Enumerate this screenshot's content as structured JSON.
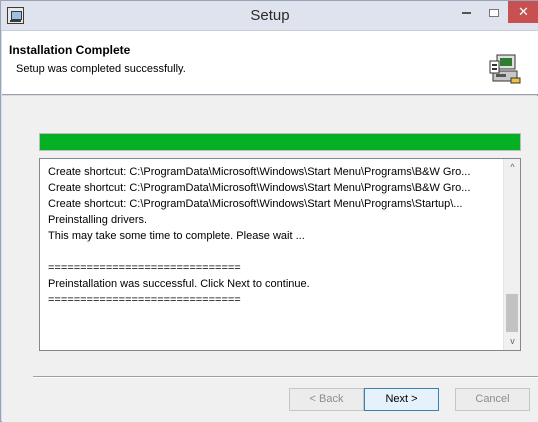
{
  "window": {
    "title": "Setup",
    "close_symbol": "✕"
  },
  "header": {
    "title": "Installation Complete",
    "subtitle": "Setup was completed successfully.",
    "icon": "installer-computer-icon"
  },
  "progress": {
    "percent": 100,
    "color": "#06b025"
  },
  "log": {
    "lines": [
      "Create shortcut: C:\\ProgramData\\Microsoft\\Windows\\Start Menu\\Programs\\B&W Gro...",
      "Create shortcut: C:\\ProgramData\\Microsoft\\Windows\\Start Menu\\Programs\\B&W Gro...",
      "Create shortcut: C:\\ProgramData\\Microsoft\\Windows\\Start Menu\\Programs\\Startup\\...",
      "Preinstalling drivers.",
      "This may take some time to complete. Please wait ...",
      "",
      "==============================",
      "Preinstallation was successful. Click Next to continue.",
      "=============================="
    ],
    "scroll_up": "^",
    "scroll_down": "v"
  },
  "buttons": {
    "back": "< Back",
    "next": "Next >",
    "cancel": "Cancel"
  }
}
